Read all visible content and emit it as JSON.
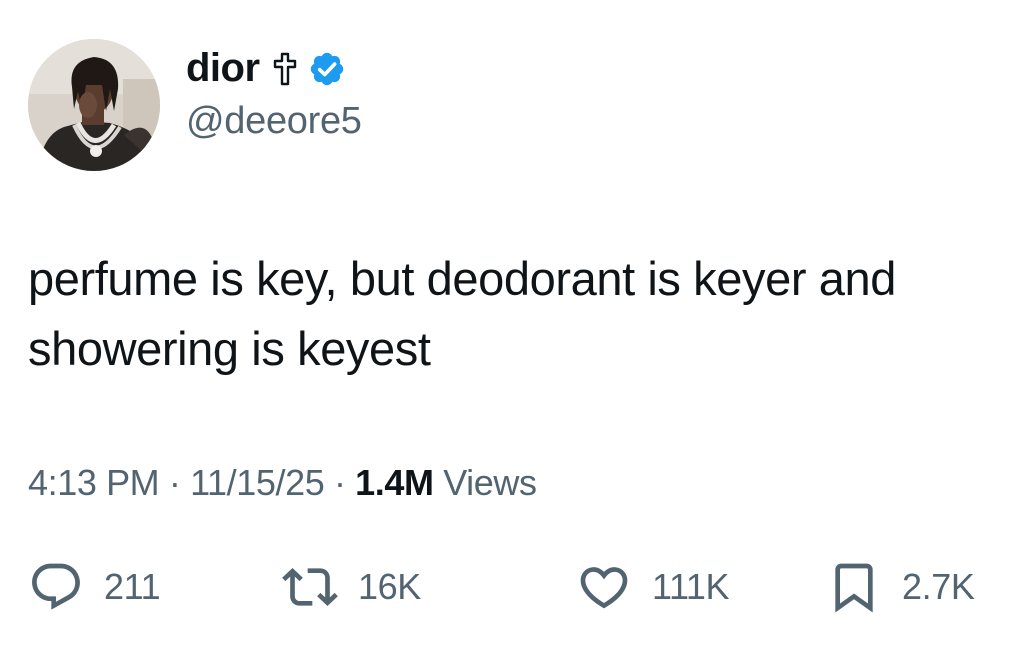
{
  "author": {
    "display_name": "dior",
    "name_emoji": "✝",
    "verified_icon": "verified-badge-icon",
    "handle": "@deeore5",
    "avatar": "avatar-photo"
  },
  "tweet": {
    "text": "perfume is key, but deodorant is keyer and showering is keyest"
  },
  "meta": {
    "time": "4:13 PM",
    "separator": "·",
    "date": "11/15/25",
    "views_count": "1.4M",
    "views_label": "Views"
  },
  "actions": {
    "reply": {
      "icon": "reply-icon",
      "count": "211"
    },
    "retweet": {
      "icon": "retweet-icon",
      "count": "16K"
    },
    "like": {
      "icon": "heart-icon",
      "count": "111K"
    },
    "bookmark": {
      "icon": "bookmark-icon",
      "count": "2.7K"
    }
  },
  "colors": {
    "text_primary": "#0f1419",
    "text_secondary": "#536471",
    "verified_blue": "#1d9bf0",
    "background": "#ffffff"
  }
}
